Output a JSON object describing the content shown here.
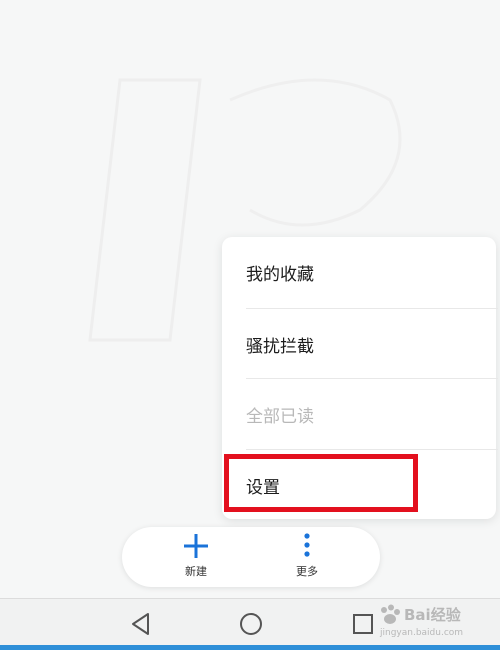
{
  "menu": {
    "items": [
      {
        "label": "我的收藏",
        "enabled": true
      },
      {
        "label": "骚扰拦截",
        "enabled": true
      },
      {
        "label": "全部已读",
        "enabled": false
      },
      {
        "label": "设置",
        "enabled": true,
        "highlighted": true
      }
    ]
  },
  "toolbar": {
    "new_label": "新建",
    "more_label": "更多",
    "new_icon": "plus-icon",
    "more_icon": "more-vertical-icon"
  },
  "navbar": {
    "back_icon": "back-triangle-icon",
    "home_icon": "home-circle-icon",
    "recent_icon": "recent-square-icon"
  },
  "watermark": {
    "brand": "Bai经验",
    "url": "jingyan.baidu.com"
  },
  "colors": {
    "accent": "#1a73d9",
    "highlight": "#e3101e",
    "disabled_text": "#b8b8b8"
  }
}
